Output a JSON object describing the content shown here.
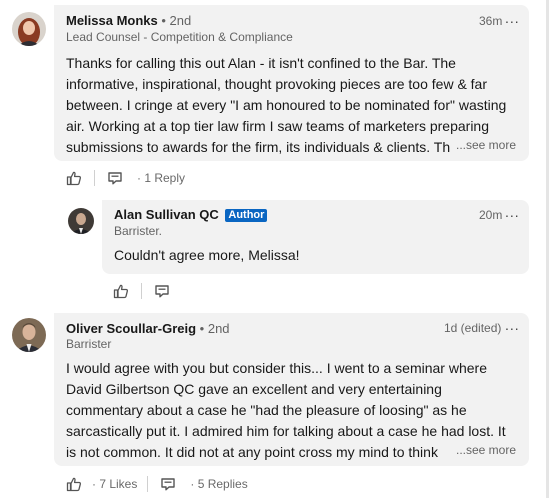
{
  "comments": [
    {
      "author": "Melissa Monks",
      "degree": "• 2nd",
      "headline": "Lead Counsel - Competition & Compliance",
      "time": "36m",
      "more": "...",
      "lines": [
        "Thanks for calling this out Alan - it isn't confined to the Bar. The",
        "informative, inspirational, thought provoking pieces are too few & far",
        "between. I cringe at every \"I am honoured to be nominated for\" wasting",
        "air. Working at a top tier law firm I saw teams of marketers preparing",
        "submissions to awards for the firm, its individuals & clients. Th"
      ],
      "see_more": "...see more",
      "replies_label": "· 1 Reply"
    },
    {
      "author": "Alan Sullivan QC",
      "badge": "Author",
      "headline": "Barrister.",
      "time": "20m",
      "more": "...",
      "text": "Couldn't agree more, Melissa!"
    },
    {
      "author": "Oliver Scoullar-Greig",
      "degree": "• 2nd",
      "headline": "Barrister",
      "time": "1d (edited)",
      "more": "...",
      "lines": [
        "I would agree with you but consider this... I went to a seminar where",
        "David Gilbertson QC gave an excellent and very entertaining",
        "commentary about a case he \"had the pleasure of loosing\" as he",
        "sarcastically put it. I admired him for talking about a case he had lost. It",
        "is not common. It did not at any point cross my mind to think"
      ],
      "see_more": "...see more",
      "likes_label": "· 7 Likes",
      "replies_label": "· 5 Replies"
    }
  ],
  "icons": {
    "like": "like-icon",
    "reply": "reply-icon"
  },
  "colors": {
    "bubble": "#f2f2f2",
    "author_badge": "#0a66c2"
  }
}
